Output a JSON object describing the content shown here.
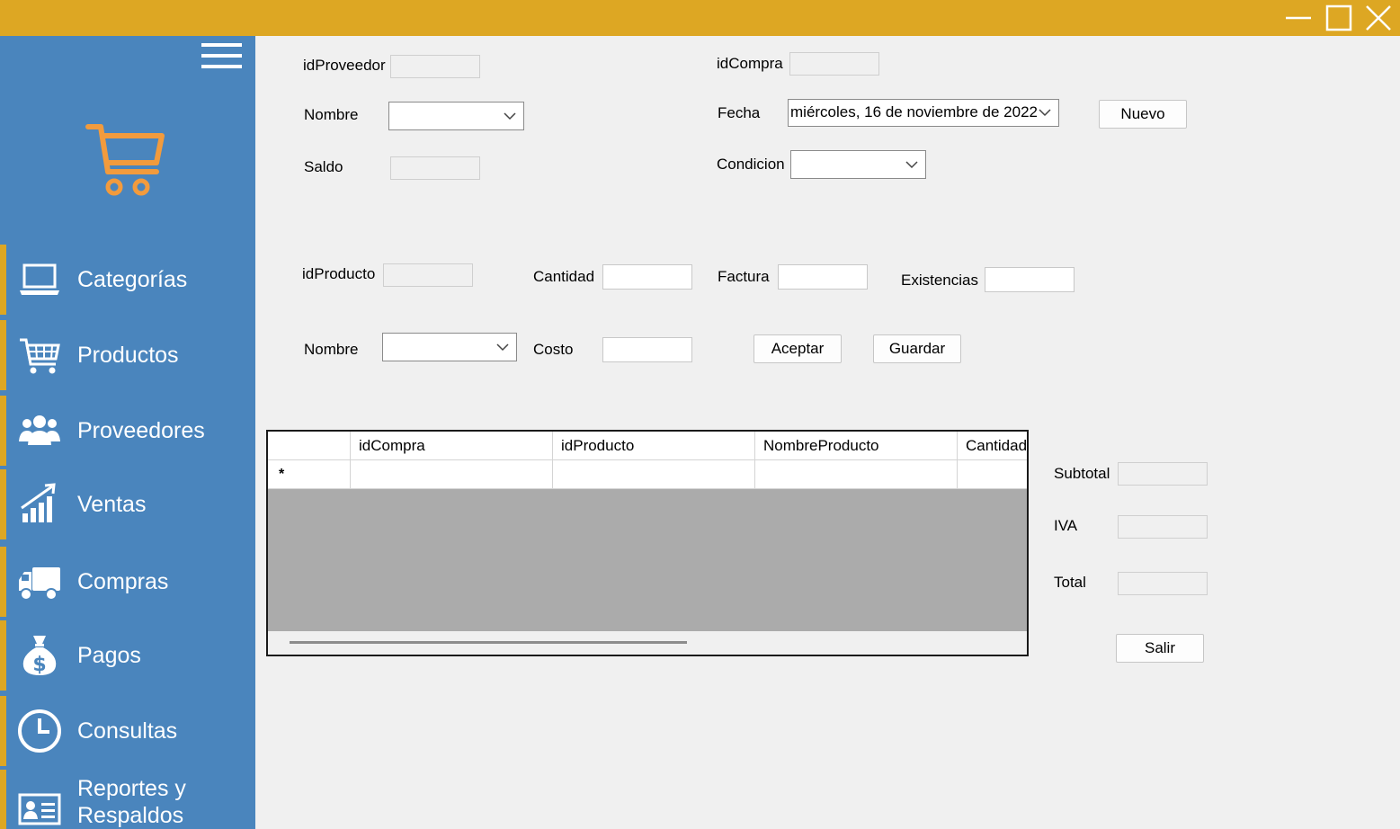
{
  "window": {
    "titlebar_color": "#dda723",
    "controls": [
      "minimize-icon",
      "maximize-icon",
      "close-icon"
    ]
  },
  "sidebar": {
    "background": "#4a85bd",
    "accent": "#dda723",
    "logo_icon": "shopping-cart-icon",
    "items": [
      {
        "label": "Categorías",
        "icon": "laptop-icon"
      },
      {
        "label": "Productos",
        "icon": "cart-icon"
      },
      {
        "label": "Proveedores",
        "icon": "users-icon"
      },
      {
        "label": "Ventas",
        "icon": "chart-icon"
      },
      {
        "label": "Compras",
        "icon": "truck-icon"
      },
      {
        "label": "Pagos",
        "icon": "money-bag-icon"
      },
      {
        "label": "Consultas",
        "icon": "clock-icon"
      },
      {
        "label_line1": "Reportes y",
        "label_line2": "Respaldos",
        "icon": "id-card-icon"
      }
    ]
  },
  "form": {
    "idproveedor_label": "idProveedor",
    "idproveedor_value": "",
    "nombre_label": "Nombre",
    "nombre_value": "",
    "saldo_label": "Saldo",
    "saldo_value": "",
    "idcompra_label": "idCompra",
    "idcompra_value": "",
    "fecha_label": "Fecha",
    "fecha_value": "miércoles, 16 de noviembre de 2022",
    "nuevo_button": "Nuevo",
    "condicion_label": "Condicion",
    "condicion_value": ""
  },
  "product": {
    "idproducto_label": "idProducto",
    "idproducto_value": "",
    "cantidad_label": "Cantidad",
    "cantidad_value": "",
    "factura_label": "Factura",
    "factura_value": "",
    "existencias_label": "Existencias",
    "existencias_value": "",
    "nombre_label": "Nombre",
    "nombre_value": "",
    "costo_label": "Costo",
    "costo_value": "",
    "aceptar_button": "Aceptar",
    "guardar_button": "Guardar"
  },
  "grid": {
    "columns": [
      "idCompra",
      "idProducto",
      "NombreProducto",
      "Cantidad"
    ],
    "new_row_marker": "*",
    "rows": []
  },
  "totals": {
    "subtotal_label": "Subtotal",
    "subtotal_value": "",
    "iva_label": "IVA",
    "iva_value": "",
    "total_label": "Total",
    "total_value": "",
    "salir_button": "Salir"
  }
}
